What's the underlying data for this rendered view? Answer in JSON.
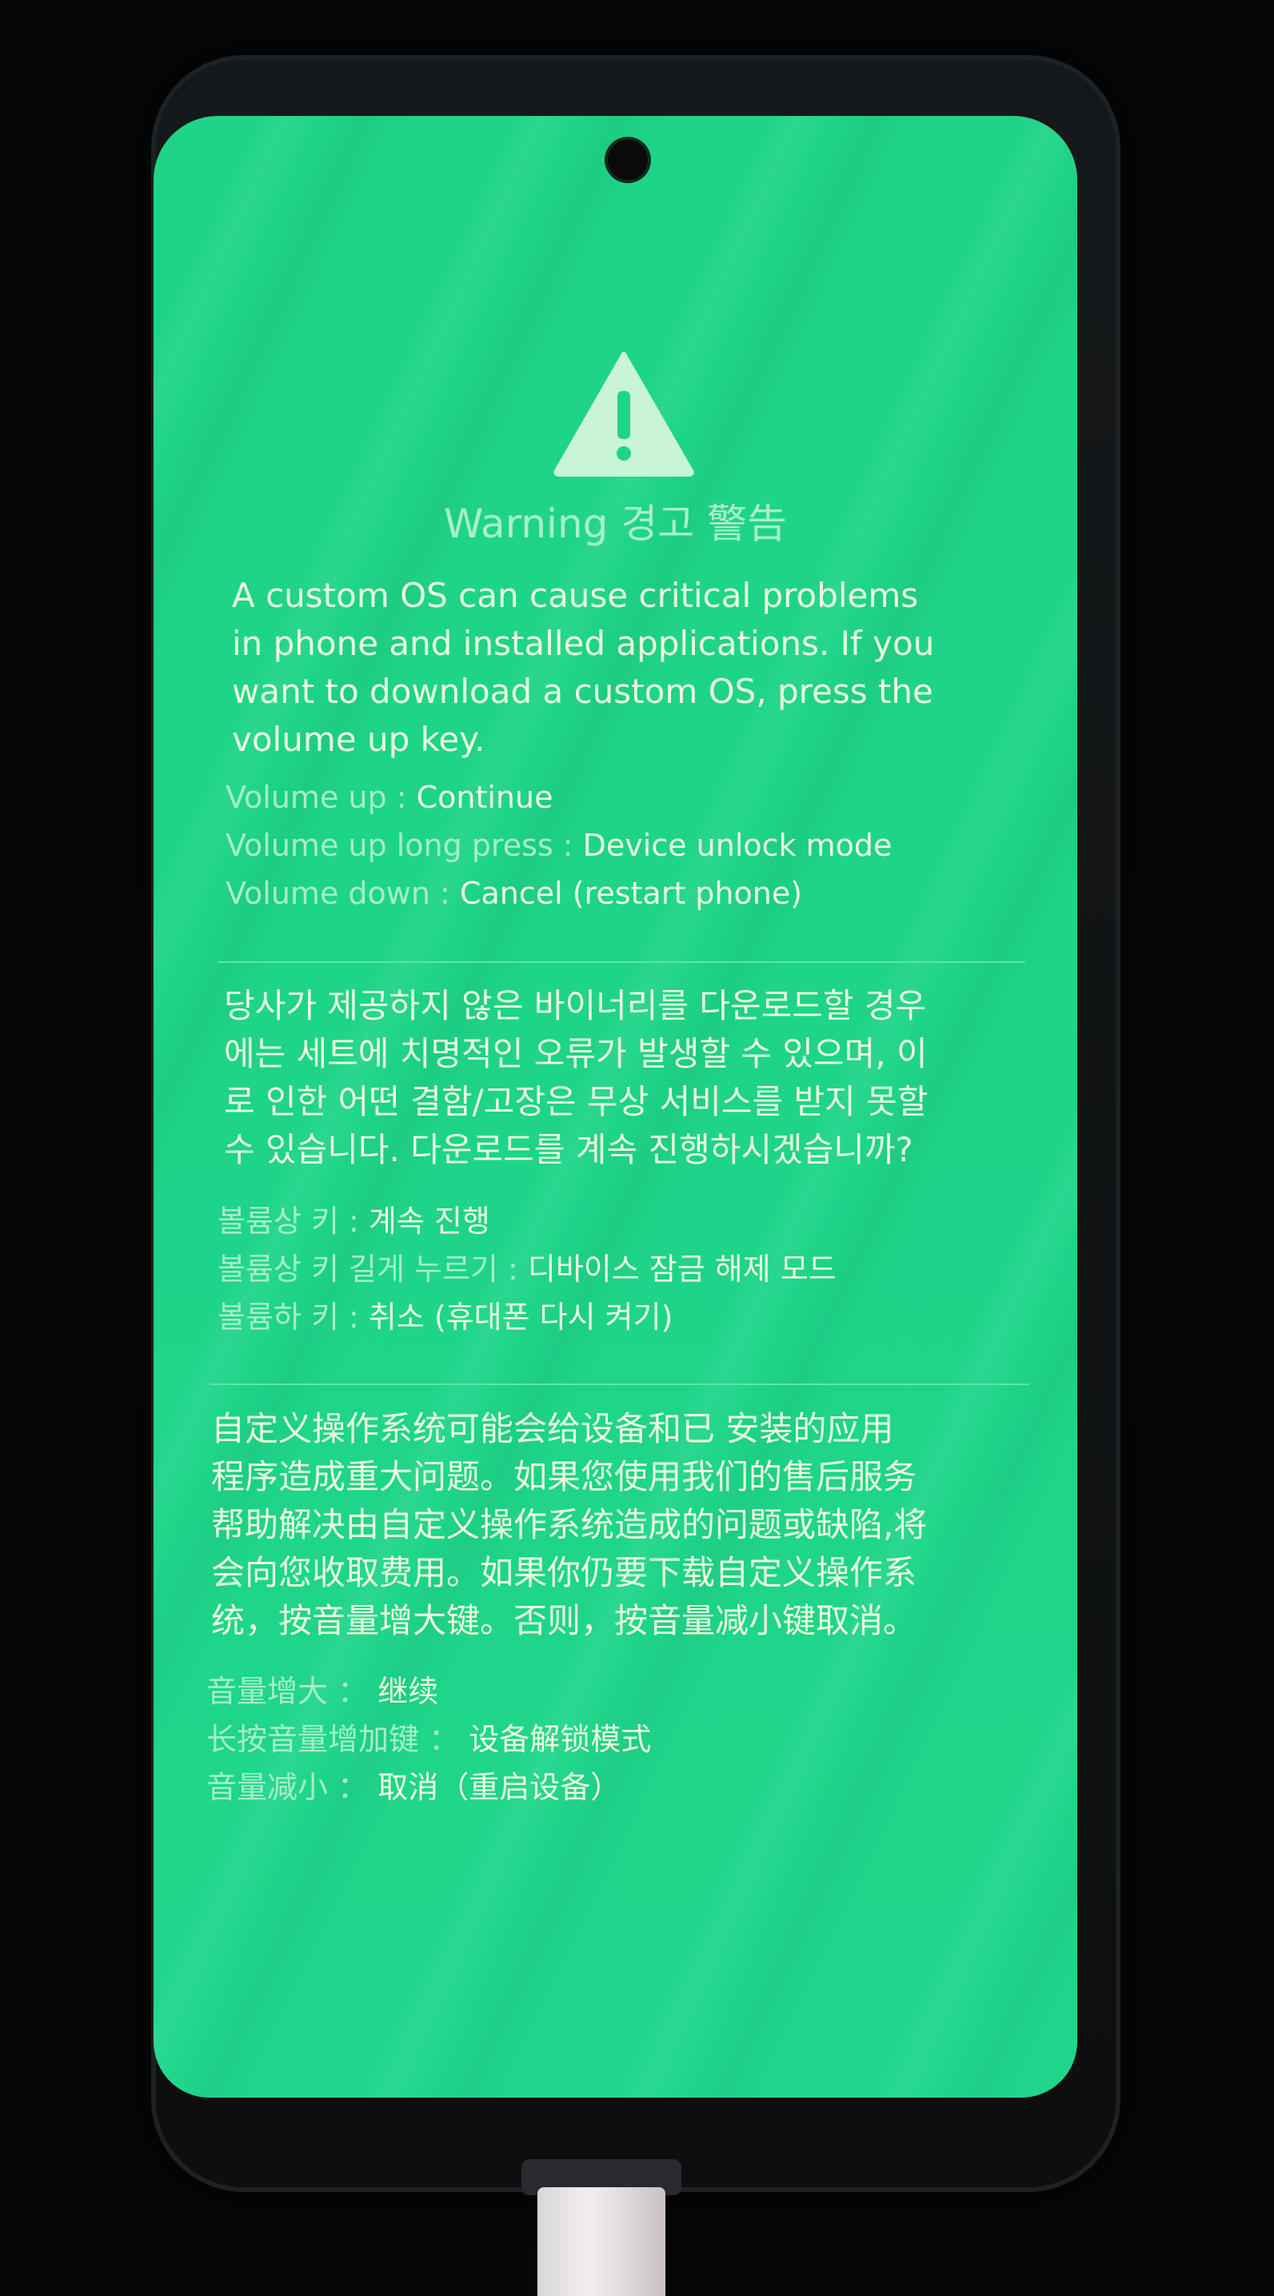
{
  "colors": {
    "screen_bg": "#1fd487",
    "text_main": "#eafbd9",
    "text_label": "#a6eec7",
    "icon": "#c9f5d4"
  },
  "header": {
    "icon": "warning-triangle-icon",
    "title": "Warning 경고 警告"
  },
  "english": {
    "message": "A custom OS can cause critical problems\nin phone and installed applications. If you\nwant to download a custom OS, press the\nvolume up key.",
    "keys": [
      {
        "label": "Volume up",
        "sep": " : ",
        "action": "Continue"
      },
      {
        "label": "Volume up long press",
        "sep": " : ",
        "action": "Device unlock mode"
      },
      {
        "label": "Volume down",
        "sep": " : ",
        "action": "Cancel (restart phone)"
      }
    ]
  },
  "korean": {
    "message": "당사가 제공하지 않은 바이너리를 다운로드할 경우\n에는 세트에 치명적인 오류가 발생할 수 있으며, 이\n로 인한 어떤 결함/고장은 무상 서비스를 받지 못할\n수 있습니다. 다운로드를 계속 진행하시겠습니까?",
    "keys": [
      {
        "label": "볼륨상 키",
        "sep": " : ",
        "action": "계속 진행"
      },
      {
        "label": "볼륨상 키 길게 누르기",
        "sep": " : ",
        "action": "디바이스 잠금 해제 모드"
      },
      {
        "label": "볼륨하 키",
        "sep": " : ",
        "action": "취소 (휴대폰 다시 켜기)"
      }
    ]
  },
  "chinese": {
    "message": "自定义操作系统可能会给设备和已  安装的应用\n程序造成重大问题。如果您使用我们的售后服务\n帮助解决由自定义操作系统造成的问题或缺陷,将\n会向您收取费用。如果你仍要下载自定义操作系\n统，按音量增大键。否则，按音量减小键取消。",
    "keys": [
      {
        "label": "音量增大",
        "sep": " ： ",
        "action": "继续"
      },
      {
        "label": "长按音量增加键",
        "sep": " ： ",
        "action": "设备解锁模式"
      },
      {
        "label": "音量减小",
        "sep": " ： ",
        "action": "取消（重启设备）"
      }
    ]
  }
}
